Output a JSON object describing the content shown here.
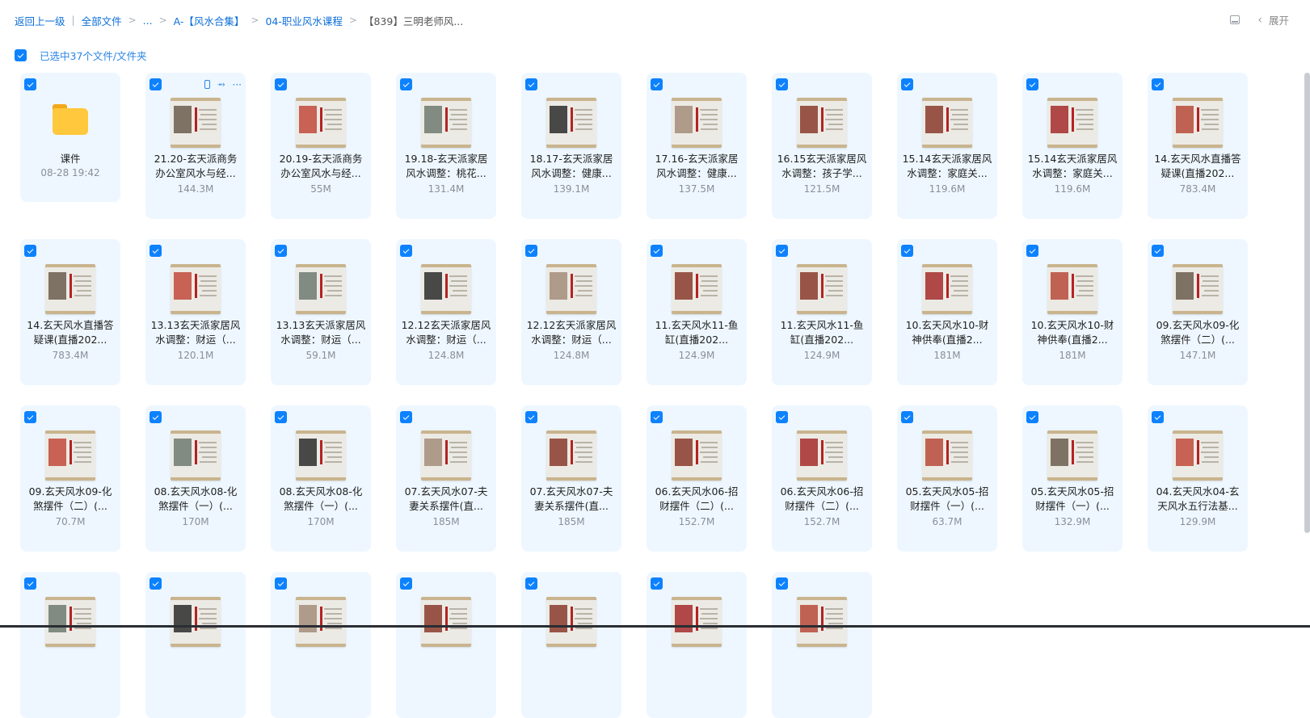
{
  "breadcrumb": {
    "back": "返回上一级",
    "items": [
      "全部文件",
      "...",
      "A-【风水合集】",
      "04-职业风水课程",
      "【839】三明老师风..."
    ]
  },
  "topbar": {
    "expand_label": "展开"
  },
  "selection": {
    "label": "已选中37个文件/文件夹"
  },
  "colors": {
    "accent": "#0d82ff",
    "card_bg": "#eef7ff"
  },
  "files": [
    {
      "name": "课件",
      "meta": "08-28 19:42",
      "type": "folder"
    },
    {
      "name": "21.20-玄天派商务办公室风水与经...",
      "meta": "144.3M",
      "type": "video",
      "actions": true
    },
    {
      "name": "20.19-玄天派商务办公室风水与经...",
      "meta": "55M",
      "type": "video"
    },
    {
      "name": "19.18-玄天派家居风水调整：桃花...",
      "meta": "131.4M",
      "type": "video"
    },
    {
      "name": "18.17-玄天派家居风水调整：健康...",
      "meta": "139.1M",
      "type": "video"
    },
    {
      "name": "17.16-玄天派家居风水调整：健康...",
      "meta": "137.5M",
      "type": "video"
    },
    {
      "name": "16.15玄天派家居风水调整：孩子学...",
      "meta": "121.5M",
      "type": "video"
    },
    {
      "name": "15.14玄天派家居风水调整：家庭关...",
      "meta": "119.6M",
      "type": "video"
    },
    {
      "name": "15.14玄天派家居风水调整：家庭关...",
      "meta": "119.6M",
      "type": "video"
    },
    {
      "name": "14.玄天风水直播答疑课(直播202...",
      "meta": "783.4M",
      "type": "video"
    },
    {
      "name": "14.玄天风水直播答疑课(直播202...",
      "meta": "783.4M",
      "type": "video"
    },
    {
      "name": "13.13玄天派家居风水调整：财运（...",
      "meta": "120.1M",
      "type": "video"
    },
    {
      "name": "13.13玄天派家居风水调整：财运（...",
      "meta": "59.1M",
      "type": "video"
    },
    {
      "name": "12.12玄天派家居风水调整：财运（...",
      "meta": "124.8M",
      "type": "video"
    },
    {
      "name": "12.12玄天派家居风水调整：财运（...",
      "meta": "124.8M",
      "type": "video"
    },
    {
      "name": "11.玄天风水11-鱼缸(直播202...",
      "meta": "124.9M",
      "type": "video"
    },
    {
      "name": "11.玄天风水11-鱼缸(直播202...",
      "meta": "124.9M",
      "type": "video"
    },
    {
      "name": "10.玄天风水10-财神供奉(直播2...",
      "meta": "181M",
      "type": "video"
    },
    {
      "name": "10.玄天风水10-财神供奉(直播2...",
      "meta": "181M",
      "type": "video"
    },
    {
      "name": "09.玄天风水09-化煞摆件（二）(...",
      "meta": "147.1M",
      "type": "video"
    },
    {
      "name": "09.玄天风水09-化煞摆件（二）(...",
      "meta": "70.7M",
      "type": "video"
    },
    {
      "name": "08.玄天风水08-化煞摆件（一）(...",
      "meta": "170M",
      "type": "video"
    },
    {
      "name": "08.玄天风水08-化煞摆件（一）(...",
      "meta": "170M",
      "type": "video"
    },
    {
      "name": "07.玄天风水07-夫妻关系摆件(直...",
      "meta": "185M",
      "type": "video"
    },
    {
      "name": "07.玄天风水07-夫妻关系摆件(直...",
      "meta": "185M",
      "type": "video"
    },
    {
      "name": "06.玄天风水06-招财摆件（二）(...",
      "meta": "152.7M",
      "type": "video"
    },
    {
      "name": "06.玄天风水06-招财摆件（二）(...",
      "meta": "152.7M",
      "type": "video"
    },
    {
      "name": "05.玄天风水05-招财摆件（一）(...",
      "meta": "63.7M",
      "type": "video"
    },
    {
      "name": "05.玄天风水05-招财摆件（一）(...",
      "meta": "132.9M",
      "type": "video"
    },
    {
      "name": "04.玄天风水04-玄天风水五行法基...",
      "meta": "129.9M",
      "type": "video"
    },
    {
      "name": "",
      "meta": "",
      "type": "video"
    },
    {
      "name": "",
      "meta": "",
      "type": "video"
    },
    {
      "name": "",
      "meta": "",
      "type": "video"
    },
    {
      "name": "",
      "meta": "",
      "type": "video"
    },
    {
      "name": "",
      "meta": "",
      "type": "video"
    },
    {
      "name": "",
      "meta": "",
      "type": "video"
    },
    {
      "name": "",
      "meta": "",
      "type": "video"
    }
  ]
}
